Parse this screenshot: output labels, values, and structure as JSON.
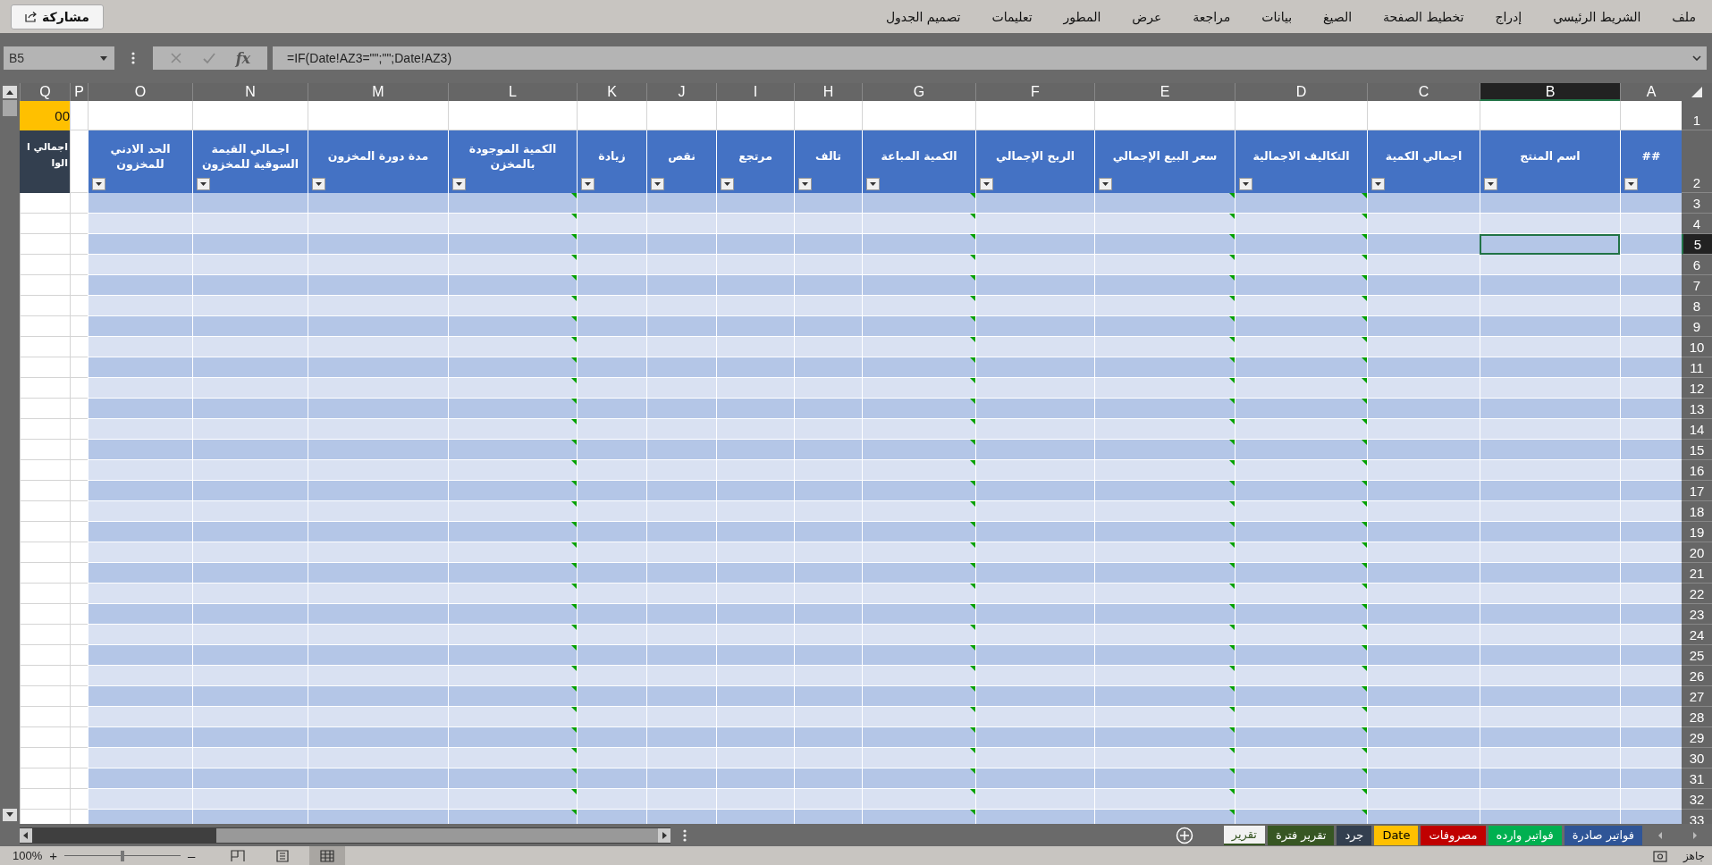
{
  "ribbon": {
    "share_button": "مشاركة",
    "tabs": [
      {
        "label": "ملف"
      },
      {
        "label": "الشريط الرئيسي"
      },
      {
        "label": "إدراج"
      },
      {
        "label": "تخطيط الصفحة"
      },
      {
        "label": "الصيغ"
      },
      {
        "label": "بيانات"
      },
      {
        "label": "مراجعة"
      },
      {
        "label": "عرض"
      },
      {
        "label": "المطور"
      },
      {
        "label": "تعليمات"
      },
      {
        "label": "تصميم الجدول"
      }
    ]
  },
  "formula_bar": {
    "name_box": "B5",
    "function_button": "fx",
    "formula": "=IF(Date!AZ3=\"\";\"\";Date!AZ3)"
  },
  "sheet": {
    "columns": [
      {
        "letter": "A",
        "kind": "table",
        "header": "##",
        "selected": false
      },
      {
        "letter": "B",
        "kind": "table",
        "header": "اسم المنتج",
        "selected": true
      },
      {
        "letter": "C",
        "kind": "table",
        "header": "اجمالي الكمية",
        "selected": false
      },
      {
        "letter": "D",
        "kind": "table",
        "header": "التكاليف الاجمالية",
        "selected": false,
        "error_indicator": true
      },
      {
        "letter": "E",
        "kind": "table",
        "header": "سعر البيع الإجمالي",
        "selected": false,
        "error_indicator": true
      },
      {
        "letter": "F",
        "kind": "table",
        "header": "الربح الإجمالي",
        "selected": false
      },
      {
        "letter": "G",
        "kind": "table",
        "header": "الكمية المباعة",
        "selected": false,
        "error_indicator": true
      },
      {
        "letter": "H",
        "kind": "table",
        "header": "تالف",
        "selected": false
      },
      {
        "letter": "I",
        "kind": "table",
        "header": "مرتجع",
        "selected": false
      },
      {
        "letter": "J",
        "kind": "table",
        "header": "نقص",
        "selected": false
      },
      {
        "letter": "K",
        "kind": "table",
        "header": "زيادة",
        "selected": false
      },
      {
        "letter": "L",
        "kind": "table",
        "header": "الكمية الموجودة بالمخزن",
        "selected": false,
        "error_indicator": true
      },
      {
        "letter": "M",
        "kind": "table",
        "header": "مدة دورة المخزون",
        "selected": false
      },
      {
        "letter": "N",
        "kind": "table",
        "header": "اجمالي القيمة السوقية للمخزون",
        "selected": false
      },
      {
        "letter": "O",
        "kind": "table",
        "header": "الحد الادني للمخزون",
        "selected": false
      },
      {
        "letter": "P",
        "kind": "blank",
        "selected": false
      },
      {
        "letter": "Q",
        "kind": "total",
        "header": "اجمالي ا\nالوا",
        "top_value": "00",
        "selected": false
      }
    ],
    "rows": [
      {
        "number": "1",
        "kind": "title",
        "selected": false
      },
      {
        "number": "2",
        "kind": "header",
        "selected": false
      },
      {
        "number": "3",
        "kind": "data",
        "selected": false
      },
      {
        "number": "4",
        "kind": "data",
        "selected": false
      },
      {
        "number": "5",
        "kind": "data",
        "selected": true
      },
      {
        "number": "6",
        "kind": "data",
        "selected": false
      },
      {
        "number": "7",
        "kind": "data",
        "selected": false
      },
      {
        "number": "8",
        "kind": "data",
        "selected": false
      },
      {
        "number": "9",
        "kind": "data",
        "selected": false
      },
      {
        "number": "10",
        "kind": "data",
        "selected": false
      },
      {
        "number": "11",
        "kind": "data",
        "selected": false
      },
      {
        "number": "12",
        "kind": "data",
        "selected": false
      },
      {
        "number": "13",
        "kind": "data",
        "selected": false
      },
      {
        "number": "14",
        "kind": "data",
        "selected": false
      },
      {
        "number": "15",
        "kind": "data",
        "selected": false
      },
      {
        "number": "16",
        "kind": "data",
        "selected": false
      },
      {
        "number": "17",
        "kind": "data",
        "selected": false
      },
      {
        "number": "18",
        "kind": "data",
        "selected": false
      },
      {
        "number": "19",
        "kind": "data",
        "selected": false
      },
      {
        "number": "20",
        "kind": "data",
        "selected": false
      },
      {
        "number": "21",
        "kind": "data",
        "selected": false
      },
      {
        "number": "22",
        "kind": "data",
        "selected": false
      },
      {
        "number": "23",
        "kind": "data",
        "selected": false
      },
      {
        "number": "24",
        "kind": "data",
        "selected": false
      },
      {
        "number": "25",
        "kind": "data",
        "selected": false
      },
      {
        "number": "26",
        "kind": "data",
        "selected": false
      },
      {
        "number": "27",
        "kind": "data",
        "selected": false
      },
      {
        "number": "28",
        "kind": "data",
        "selected": false
      },
      {
        "number": "29",
        "kind": "data",
        "selected": false
      },
      {
        "number": "30",
        "kind": "data",
        "selected": false
      },
      {
        "number": "31",
        "kind": "data",
        "selected": false
      },
      {
        "number": "32",
        "kind": "data",
        "selected": false
      },
      {
        "number": "33",
        "kind": "data",
        "selected": false
      }
    ]
  },
  "sheet_tabs": [
    {
      "label": "فواتير صادرة",
      "color": "#2f5597",
      "selected": false
    },
    {
      "label": "فواتير وارده",
      "color": "#00b050",
      "selected": false
    },
    {
      "label": "مصروفات",
      "color": "#c00000",
      "selected": false
    },
    {
      "label": "Date",
      "color": "#ffc000",
      "selected": false
    },
    {
      "label": "جرد",
      "color": "#333f4f",
      "selected": false
    },
    {
      "label": "تقرير فترة",
      "color": "#375623",
      "selected": false
    },
    {
      "label": "تقرير",
      "color": "#375623",
      "selected": true
    }
  ],
  "status_bar": {
    "ready": "جاهز",
    "zoom": "100%",
    "zoom_in": "+",
    "zoom_out": "–",
    "zoom_slider": {
      "level": 0.5
    },
    "views": [
      {
        "kind": "page_break",
        "selected": false
      },
      {
        "kind": "page_layout",
        "selected": false
      },
      {
        "kind": "normal",
        "selected": true
      }
    ]
  }
}
